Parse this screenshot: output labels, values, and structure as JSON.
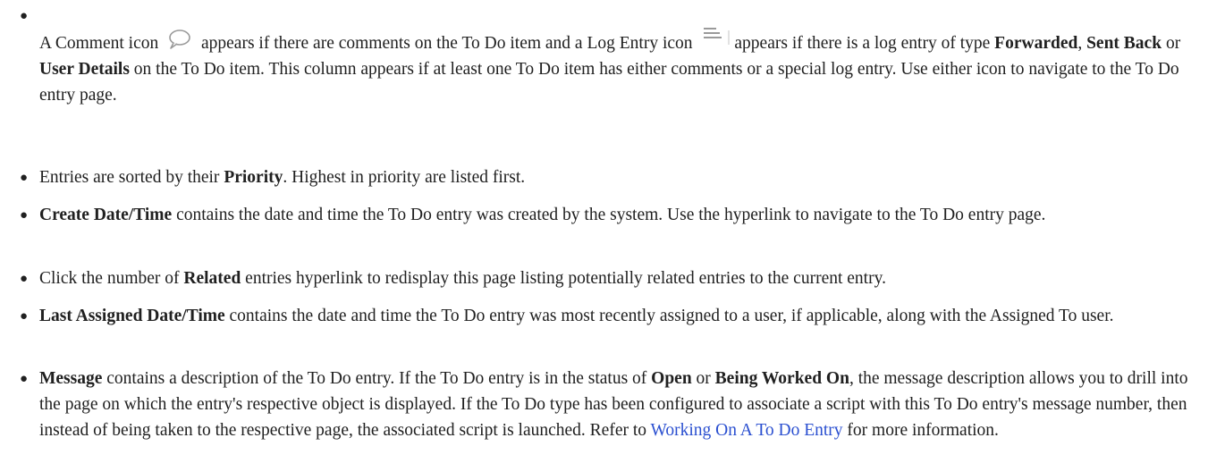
{
  "items": [
    {
      "pre_comment": "A Comment icon",
      "mid_log": "appears if there are comments on the To Do item and a Log Entry icon",
      "after_log": "appears if there is a log entry of type",
      "bold_forwarded": "Forwarded",
      "sep1": ",",
      "bold_sent_back": "Sent Back",
      "or_text": "or",
      "bold_user_details": "User Details",
      "rest": "on the To Do item. This column appears if at least one To Do item has either comments or a special log entry. Use either icon to navigate to the To Do entry page.",
      "comment_icon": "comment-icon",
      "log_icon": "log-entry-icon"
    },
    {
      "pre": "Entries are sorted by their",
      "bold": "Priority",
      "post": ". Highest in priority are listed first."
    },
    {
      "bold": "Create Date/Time",
      "post": "contains the date and time the To Do entry was created by the system. Use the hyperlink to navigate to the To Do entry page."
    },
    {
      "pre": "Click the number of",
      "bold": "Related",
      "post": "entries hyperlink to redisplay this page listing potentially related entries to the current entry."
    },
    {
      "bold": "Last Assigned Date/Time",
      "post": "contains the date and time the To Do entry was most recently assigned to a user, if applicable, along with the Assigned To user."
    },
    {
      "bold": "Message",
      "text1": "contains a description of the To Do entry. If the To Do entry is in the status of",
      "bold_open": "Open",
      "or_text": "or",
      "bold_being_worked": "Being Worked On",
      "text2": ", the message description allows you to drill into the page on which the entry's respective object is displayed. If the To Do type has been configured to associate a script with this To Do entry's message number, then instead of being taken to the respective page, the associated script is launched. Refer to",
      "link": "Working On A To Do Entry",
      "text3": "for more information."
    }
  ],
  "colors": {
    "text": "#202020",
    "link": "#2a4fd0",
    "icon": "#9a9a9a"
  }
}
